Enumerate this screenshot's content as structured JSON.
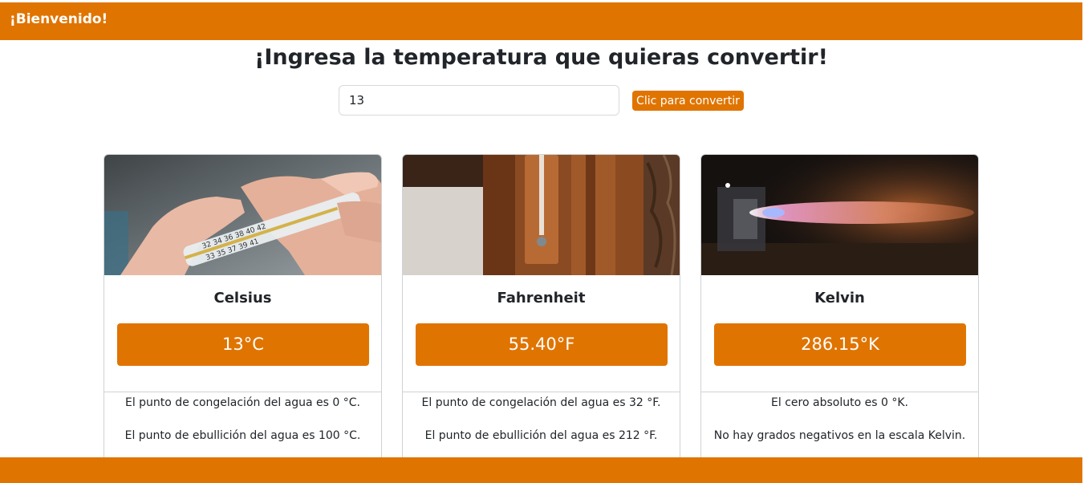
{
  "navbar": {
    "brand": "¡Bienvenido!"
  },
  "header": {
    "title": "¡Ingresa la temperatura que quieras convertir!"
  },
  "form": {
    "input_value": "13",
    "button_label": "Clic para convertir"
  },
  "cards": [
    {
      "title": "Celsius",
      "value": "13°C",
      "image": "thermometer-hand-photo",
      "facts": [
        "El punto de congelación del agua es 0 °C.",
        "El punto de ebullición del agua es 100 °C."
      ]
    },
    {
      "title": "Fahrenheit",
      "value": "55.40°F",
      "image": "wall-thermometer-photo",
      "facts": [
        "El punto de congelación del agua es 32 °F.",
        "El punto de ebullición del agua es 212 °F."
      ]
    },
    {
      "title": "Kelvin",
      "value": "286.15°K",
      "image": "rocket-engine-flame-photo",
      "facts": [
        "El cero absoluto es 0 °K.",
        "No hay grados negativos en la escala Kelvin."
      ]
    }
  ],
  "colors": {
    "accent": "#e07400",
    "text": "#212529",
    "border": "#cfd2d5"
  }
}
